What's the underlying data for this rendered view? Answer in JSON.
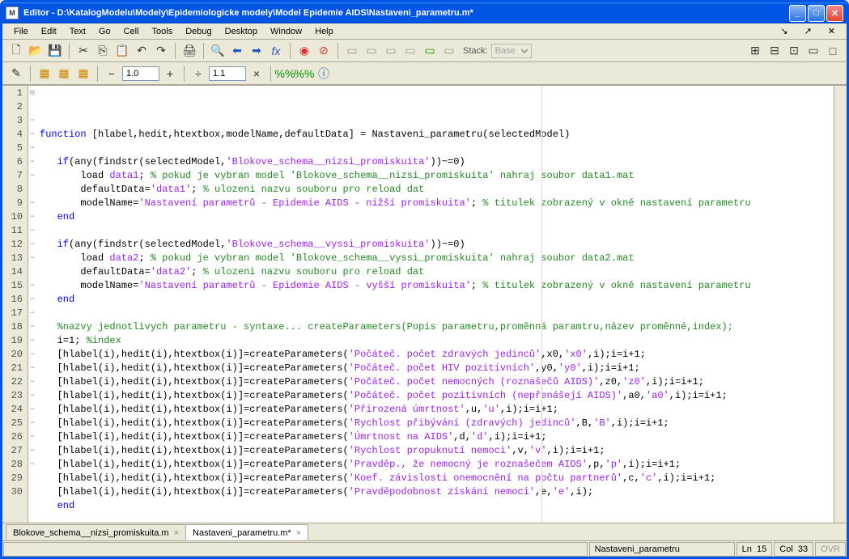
{
  "window": {
    "title": "Editor - D:\\KatalogModelu\\Modely\\Epidemiologicke modely\\Model Epidemie AIDS\\Nastaveni_parametru.m*"
  },
  "menu": {
    "file": "File",
    "edit": "Edit",
    "text": "Text",
    "go": "Go",
    "cell": "Cell",
    "tools": "Tools",
    "debug": "Debug",
    "desktop": "Desktop",
    "window": "Window",
    "help": "Help"
  },
  "toolbar": {
    "stack_label": "Stack:",
    "stack_value": "Base",
    "cell_inc": "1.0",
    "cell_mult": "1.1"
  },
  "tabs": [
    {
      "label": "Blokove_schema__nizsi_promiskuita.m",
      "active": false
    },
    {
      "label": "Nastaveni_parametru.m*",
      "active": true
    }
  ],
  "status": {
    "func": "Nastaveni_parametru",
    "ln_label": "Ln",
    "ln": "15",
    "col_label": "Col",
    "col": "33",
    "ovr": "OVR"
  },
  "code": {
    "lines": [
      {
        "n": 1,
        "fold": "⊟",
        "seg": [
          {
            "c": "kw",
            "t": "function"
          },
          {
            "t": " [hlabel,hedit,htextbox,modelName,defaultData] = Nastaveni_parametru(selectedModel)"
          }
        ]
      },
      {
        "n": 2,
        "seg": []
      },
      {
        "n": 3,
        "fold": "−",
        "seg": [
          {
            "t": "   "
          },
          {
            "c": "kw",
            "t": "if"
          },
          {
            "t": "(any(findstr(selectedModel,"
          },
          {
            "c": "str",
            "t": "'Blokove_schema__nizsi_promiskuita'"
          },
          {
            "t": "))~=0)"
          }
        ]
      },
      {
        "n": 4,
        "fold": "−",
        "seg": [
          {
            "t": "       load "
          },
          {
            "c": "str",
            "t": "data1"
          },
          {
            "t": "; "
          },
          {
            "c": "cmt",
            "t": "% pokud je vybran model 'Blokove_schema__nizsi_promiskuita' nahraj soubor data1.mat"
          }
        ]
      },
      {
        "n": 5,
        "fold": "−",
        "seg": [
          {
            "t": "       defaultData="
          },
          {
            "c": "str",
            "t": "'data1'"
          },
          {
            "t": "; "
          },
          {
            "c": "cmt",
            "t": "% ulozeni nazvu souboru pro reload dat"
          }
        ]
      },
      {
        "n": 6,
        "fold": "−",
        "seg": [
          {
            "t": "       modelName="
          },
          {
            "c": "str",
            "t": "'Nastavení parametrů - Epidemie AIDS - nižší promiskuita'"
          },
          {
            "t": "; "
          },
          {
            "c": "cmt",
            "t": "% titulek zobrazený v okně nastavení parametru"
          }
        ]
      },
      {
        "n": 7,
        "fold": "−",
        "seg": [
          {
            "t": "   "
          },
          {
            "c": "kw",
            "t": "end"
          }
        ]
      },
      {
        "n": 8,
        "seg": []
      },
      {
        "n": 9,
        "fold": "−",
        "seg": [
          {
            "t": "   "
          },
          {
            "c": "kw",
            "t": "if"
          },
          {
            "t": "(any(findstr(selectedModel,"
          },
          {
            "c": "str",
            "t": "'Blokove_schema__vyssi_promiskuita'"
          },
          {
            "t": "))~=0)"
          }
        ]
      },
      {
        "n": 10,
        "fold": "−",
        "seg": [
          {
            "t": "       load "
          },
          {
            "c": "str",
            "t": "data2"
          },
          {
            "t": "; "
          },
          {
            "c": "cmt",
            "t": "% pokud je vybran model 'Blokove_schema__vyssi_promiskuita' nahraj soubor data2.mat"
          }
        ]
      },
      {
        "n": 11,
        "fold": "−",
        "seg": [
          {
            "t": "       defaultData="
          },
          {
            "c": "str",
            "t": "'data2'"
          },
          {
            "t": "; "
          },
          {
            "c": "cmt",
            "t": "% ulozeni nazvu souboru pro reload dat"
          }
        ]
      },
      {
        "n": 12,
        "fold": "−",
        "seg": [
          {
            "t": "       modelName="
          },
          {
            "c": "str",
            "t": "'Nastavení parametrů - Epidemie AIDS - vyšší promiskuita'"
          },
          {
            "t": "; "
          },
          {
            "c": "cmt",
            "t": "% titulek zobrazený v okně nastavení parametru"
          }
        ]
      },
      {
        "n": 13,
        "fold": "−",
        "seg": [
          {
            "t": "   "
          },
          {
            "c": "kw",
            "t": "end"
          }
        ]
      },
      {
        "n": 14,
        "seg": []
      },
      {
        "n": 15,
        "fold": "−",
        "seg": [
          {
            "t": "   "
          },
          {
            "c": "cmt",
            "t": "%nazvy jednotlivych parametru - syntaxe... createParameters(Popis parametru,proměnná paramtru,název proměnné,index);"
          }
        ]
      },
      {
        "n": 16,
        "fold": "−",
        "seg": [
          {
            "t": "   i=1; "
          },
          {
            "c": "cmt",
            "t": "%index"
          }
        ]
      },
      {
        "n": 17,
        "fold": "−",
        "seg": [
          {
            "t": "   [hlabel(i),hedit(i),htextbox(i)]=createParameters("
          },
          {
            "c": "str",
            "t": "'Počáteč. počet zdravých jedinců'"
          },
          {
            "t": ",x0,"
          },
          {
            "c": "str",
            "t": "'x0'"
          },
          {
            "t": ",i);i=i+1;"
          }
        ]
      },
      {
        "n": 18,
        "fold": "−",
        "seg": [
          {
            "t": "   [hlabel(i),hedit(i),htextbox(i)]=createParameters("
          },
          {
            "c": "str",
            "t": "'Počáteč. počet HIV pozitivních'"
          },
          {
            "t": ",y0,"
          },
          {
            "c": "str",
            "t": "'y0'"
          },
          {
            "t": ",i);i=i+1;"
          }
        ]
      },
      {
        "n": 19,
        "fold": "−",
        "seg": [
          {
            "t": "   [hlabel(i),hedit(i),htextbox(i)]=createParameters("
          },
          {
            "c": "str",
            "t": "'Počáteč. počet nemocných (roznašečů AIDS)'"
          },
          {
            "t": ",z0,"
          },
          {
            "c": "str",
            "t": "'z0'"
          },
          {
            "t": ",i);i=i+1;"
          }
        ]
      },
      {
        "n": 20,
        "fold": "−",
        "seg": [
          {
            "t": "   [hlabel(i),hedit(i),htextbox(i)]=createParameters("
          },
          {
            "c": "str",
            "t": "'Počáteč. počet pozitivních (nepřenášejí AIDS)'"
          },
          {
            "t": ",a0,"
          },
          {
            "c": "str",
            "t": "'a0'"
          },
          {
            "t": ",i);i=i+1;"
          }
        ]
      },
      {
        "n": 21,
        "fold": "−",
        "seg": [
          {
            "t": "   [hlabel(i),hedit(i),htextbox(i)]=createParameters("
          },
          {
            "c": "str",
            "t": "'Přirozená úmrtnost'"
          },
          {
            "t": ",u,"
          },
          {
            "c": "str",
            "t": "'u'"
          },
          {
            "t": ",i);i=i+1;"
          }
        ]
      },
      {
        "n": 22,
        "fold": "−",
        "seg": [
          {
            "t": "   [hlabel(i),hedit(i),htextbox(i)]=createParameters("
          },
          {
            "c": "str",
            "t": "'Rychlost přibývání (zdravých) jedinců'"
          },
          {
            "t": ",B,"
          },
          {
            "c": "str",
            "t": "'B'"
          },
          {
            "t": ",i);i=i+1;"
          }
        ]
      },
      {
        "n": 23,
        "fold": "−",
        "seg": [
          {
            "t": "   [hlabel(i),hedit(i),htextbox(i)]=createParameters("
          },
          {
            "c": "str",
            "t": "'Úmrtnost na AIDS'"
          },
          {
            "t": ",d,"
          },
          {
            "c": "str",
            "t": "'d'"
          },
          {
            "t": ",i);i=i+1;"
          }
        ]
      },
      {
        "n": 24,
        "fold": "−",
        "seg": [
          {
            "t": "   [hlabel(i),hedit(i),htextbox(i)]=createParameters("
          },
          {
            "c": "str",
            "t": "'Rychlost propuknutí nemoci'"
          },
          {
            "t": ",v,"
          },
          {
            "c": "str",
            "t": "'v'"
          },
          {
            "t": ",i);i=i+1;"
          }
        ]
      },
      {
        "n": 25,
        "fold": "−",
        "seg": [
          {
            "t": "   [hlabel(i),hedit(i),htextbox(i)]=createParameters("
          },
          {
            "c": "str",
            "t": "'Pravděp., že nemocný je roznašečem AIDS'"
          },
          {
            "t": ",p,"
          },
          {
            "c": "str",
            "t": "'p'"
          },
          {
            "t": ",i);i=i+1;"
          }
        ]
      },
      {
        "n": 26,
        "fold": "−",
        "seg": [
          {
            "t": "   [hlabel(i),hedit(i),htextbox(i)]=createParameters("
          },
          {
            "c": "str",
            "t": "'Koef. závislosti onemocnění na počtu partnerů'"
          },
          {
            "t": ",c,"
          },
          {
            "c": "str",
            "t": "'c'"
          },
          {
            "t": ",i);i=i+1;"
          }
        ]
      },
      {
        "n": 27,
        "fold": "−",
        "seg": [
          {
            "t": "   [hlabel(i),hedit(i),htextbox(i)]=createParameters("
          },
          {
            "c": "str",
            "t": "'Pravděpodobnost získání nemoci'"
          },
          {
            "t": ",e,"
          },
          {
            "c": "str",
            "t": "'e'"
          },
          {
            "t": ",i);"
          }
        ]
      },
      {
        "n": 28,
        "fold": "−",
        "seg": [
          {
            "t": "   "
          },
          {
            "c": "kw",
            "t": "end"
          }
        ]
      },
      {
        "n": 29,
        "seg": []
      },
      {
        "n": 30,
        "seg": []
      }
    ]
  }
}
